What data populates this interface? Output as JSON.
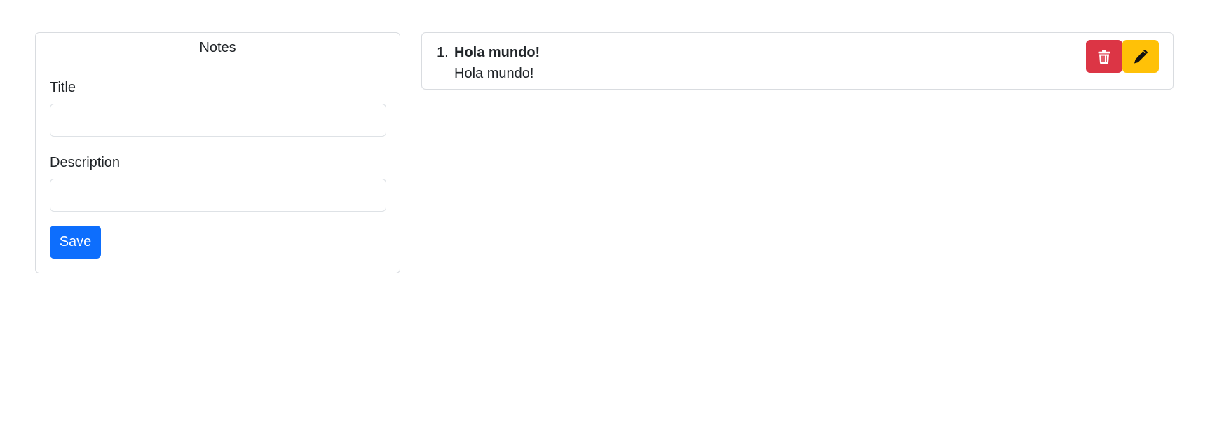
{
  "form": {
    "title": "Notes",
    "title_label": "Title",
    "title_value": "",
    "description_label": "Description",
    "description_value": "",
    "save_label": "Save"
  },
  "notes": [
    {
      "number": "1.",
      "title": "Hola mundo!",
      "description": "Hola mundo!",
      "delete_icon": "trash-icon",
      "edit_icon": "pencil-icon"
    }
  ],
  "colors": {
    "primary": "#0d6efd",
    "danger": "#dc3545",
    "warning": "#ffc107"
  }
}
